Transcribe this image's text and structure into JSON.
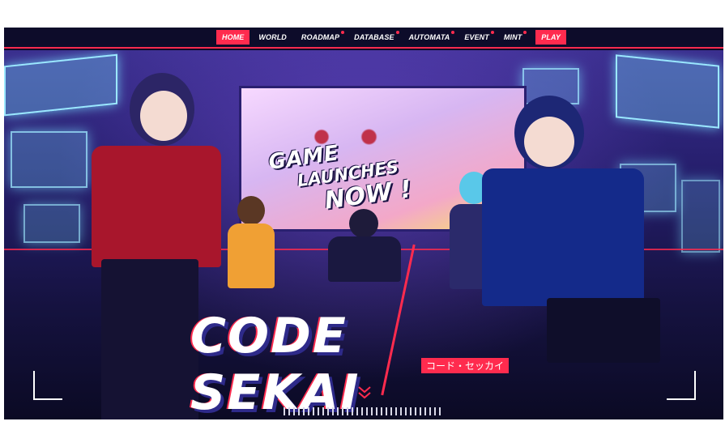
{
  "nav": {
    "items": [
      {
        "label": "HOME",
        "active": true,
        "dot": false
      },
      {
        "label": "WORLD",
        "active": false,
        "dot": false
      },
      {
        "label": "ROADMAP",
        "active": false,
        "dot": true
      },
      {
        "label": "DATABASE",
        "active": false,
        "dot": true
      },
      {
        "label": "AUTOMATA",
        "active": false,
        "dot": true
      },
      {
        "label": "EVENT",
        "active": false,
        "dot": true
      },
      {
        "label": "MINT",
        "active": false,
        "dot": true
      }
    ],
    "play_label": "PLAY"
  },
  "hero": {
    "headline": {
      "line1": "GAME",
      "line2": "LAUNCHES",
      "line3": "NOW !"
    },
    "logo": {
      "title": "CODE SEKAI",
      "subtitle": "コード・セッカイ"
    },
    "scroll_icon": "chevron-double-down-icon"
  },
  "colors": {
    "accent": "#ff2b4e",
    "navbar": "#0d0c2a",
    "panel_glow": "#9be8ff"
  }
}
